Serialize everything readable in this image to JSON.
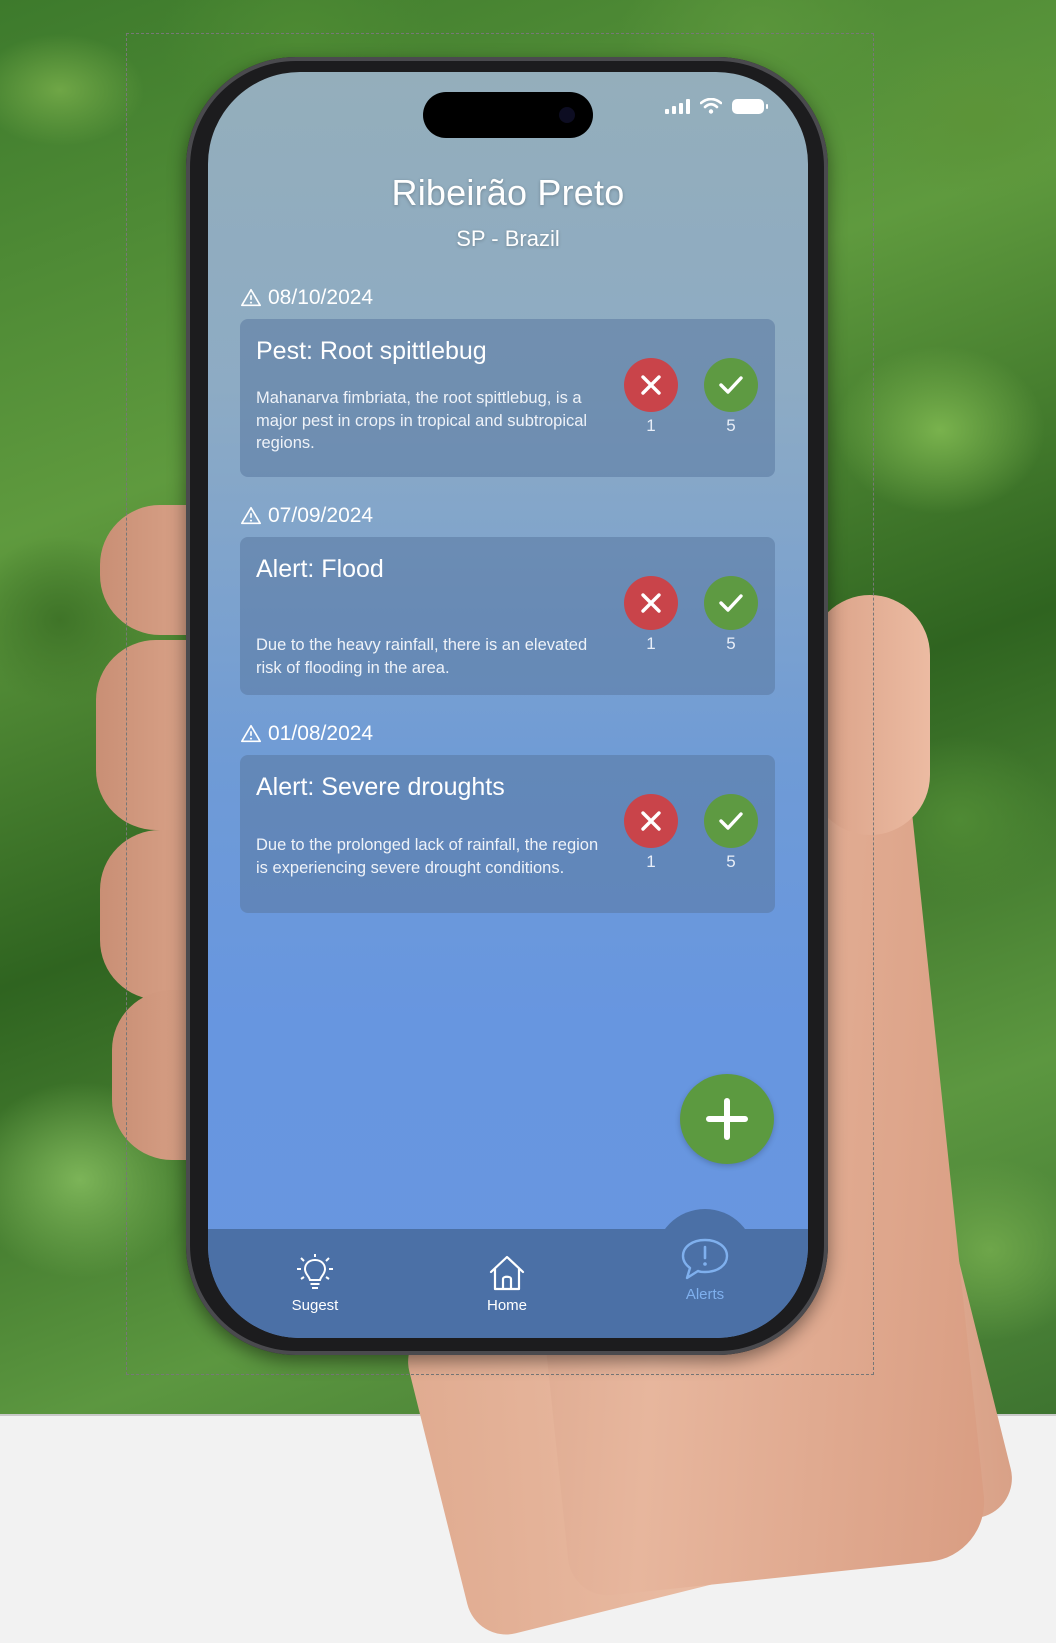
{
  "header": {
    "city": "Ribeirão Preto",
    "region": "SP - Brazil"
  },
  "alerts": [
    {
      "date": "08/10/2024",
      "title": "Pest: Root spittlebug",
      "text": "Mahanarva fimbriata, the root spittlebug, is a major pest in crops in tropical and subtropical regions.",
      "downvotes": "1",
      "upvotes": "5"
    },
    {
      "date": "07/09/2024",
      "title": "Alert: Flood",
      "text": "Due to the heavy rainfall, there is an elevated risk of flooding in the area.",
      "downvotes": "1",
      "upvotes": "5"
    },
    {
      "date": "01/08/2024",
      "title": "Alert: Severe droughts",
      "text": "Due to the prolonged lack of rainfall, the region is experiencing severe drought conditions.",
      "downvotes": "1",
      "upvotes": "5"
    }
  ],
  "tabbar": {
    "items": [
      {
        "label": "Sugest",
        "icon": "lightbulb-icon",
        "active": false
      },
      {
        "label": "Home",
        "icon": "home-icon",
        "active": false
      },
      {
        "label": "Alerts",
        "icon": "chat-alert-icon",
        "active": true
      }
    ]
  },
  "colors": {
    "screen_top": "#94aebb",
    "screen_bottom": "#6896df",
    "tabbar": "#4b70a6",
    "active_tab": "#7fb0ee",
    "reject": "#c9444a",
    "confirm": "#5e9a42",
    "fab": "#5c9a40"
  }
}
